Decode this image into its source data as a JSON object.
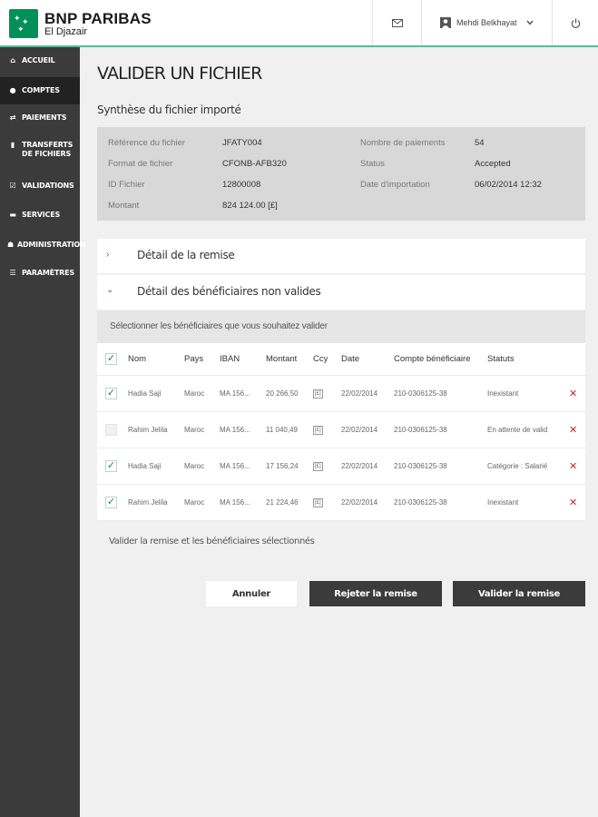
{
  "brand": {
    "name": "BNP PARIBAS",
    "sub": "El Djazair",
    "color": "#00915a"
  },
  "header": {
    "mail_icon": "envelope-icon",
    "user_name": "Mehdi Belkhayat",
    "power_icon": "power-icon"
  },
  "sidebar": {
    "items": [
      {
        "label": "ACCUEIL",
        "icon": "home-icon",
        "active": false
      },
      {
        "label": "COMPTES",
        "icon": "coins-icon",
        "active": true
      },
      {
        "label": "PAIEMENTS",
        "icon": "transfer-icon",
        "active": false
      },
      {
        "label": "TRANSFERTS",
        "label2": "DE FICHIERS",
        "icon": "file-icon",
        "active": false
      },
      {
        "label": "VALIDATIONS",
        "icon": "check-square-icon",
        "active": false
      },
      {
        "label": "SERVICES",
        "icon": "services-icon",
        "active": false
      },
      {
        "label": "ADMINISTRATION",
        "icon": "users-icon",
        "active": false
      },
      {
        "label": "PARAMÈTRES",
        "icon": "sliders-icon",
        "active": false
      }
    ]
  },
  "page": {
    "title": "VALIDER UN FICHIER",
    "summary_title": "Synthèse du fichier importé"
  },
  "summary": {
    "left": [
      {
        "label": "Référence du fichier",
        "value": "JFATY004"
      },
      {
        "label": "Format de fichier",
        "value": "CFONB-AFB320"
      },
      {
        "label": "ID Fichier",
        "value": "12800008"
      },
      {
        "label": "Montant",
        "value": "824 124.00 [£]"
      }
    ],
    "right": [
      {
        "label": "Nombre de paiements",
        "value": "54"
      },
      {
        "label": "Status",
        "value": "Accepted"
      },
      {
        "label": "Date d'importation",
        "value": "06/02/2014 12:32"
      }
    ]
  },
  "accordion": {
    "remise": "Détail de la remise",
    "beneficiaires": "Détail des bénéficiaires non valides"
  },
  "select_hint": "Sélectionner les bénéficiaires que vous souhaitez valider",
  "table": {
    "headers": [
      "Nom",
      "Pays",
      "IBAN",
      "Montant",
      "Ccy",
      "Date",
      "Compte bénéficiaire",
      "Statuts"
    ],
    "rows": [
      {
        "checked": true,
        "nom": "Hadia Saji",
        "pays": "Maroc",
        "iban": "MA 156...",
        "montant": "20 266,50",
        "ccy": "[£]",
        "date": "22/02/2014",
        "compte": "210-0306125-38",
        "statut": "Inexistant"
      },
      {
        "checked": false,
        "nom": "Rahim Jelila",
        "pays": "Maroc",
        "iban": "MA 156...",
        "montant": "11 040,49",
        "ccy": "[£]",
        "date": "22/02/2014",
        "compte": "210-0306125-38",
        "statut": "En attente de valid"
      },
      {
        "checked": true,
        "nom": "Hadia Saji",
        "pays": "Maroc",
        "iban": "MA 156...",
        "montant": "17 156,24",
        "ccy": "[£]",
        "date": "22/02/2014",
        "compte": "210-0306125-38",
        "statut": "Catégorie : Salarié"
      },
      {
        "checked": true,
        "nom": "Rahim Jelila",
        "pays": "Maroc",
        "iban": "MA 156...",
        "montant": "21 224,46",
        "ccy": "[£]",
        "date": "22/02/2014",
        "compte": "210-0306125-38",
        "statut": "Inexistant"
      }
    ]
  },
  "validate_text": "Valider la remise et les bénéficiaires sélectionnés",
  "buttons": {
    "cancel": "Annuler",
    "reject": "Rejeter la remise",
    "validate": "Valider la remise"
  },
  "colors": {
    "accent": "#00915a",
    "sidebar": "#3b3b3b",
    "delete": "#c2262e"
  }
}
